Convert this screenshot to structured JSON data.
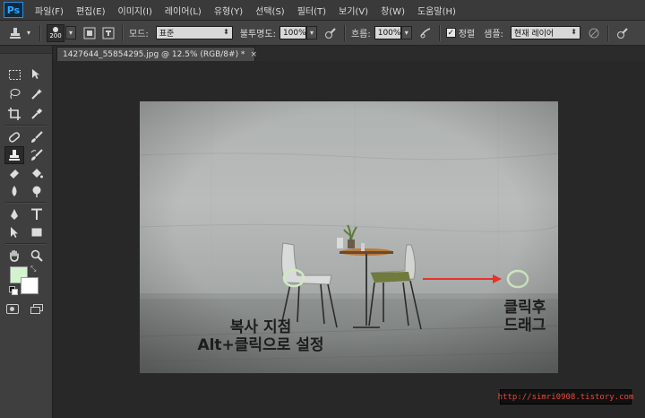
{
  "app": {
    "logo": "Ps"
  },
  "menu": [
    "파일(F)",
    "편집(E)",
    "이미지(I)",
    "레이어(L)",
    "유형(Y)",
    "선택(S)",
    "필터(T)",
    "보기(V)",
    "창(W)",
    "도움말(H)"
  ],
  "options_bar": {
    "brush_size": "200",
    "mode_label": "모드:",
    "mode_value": "표준",
    "opacity_label": "불투명도:",
    "opacity_value": "100%",
    "flow_label": "흐름:",
    "flow_value": "100%",
    "aligned_checked": true,
    "aligned_label": "정렬",
    "sample_label": "샘플:",
    "sample_value": "현재 레이어"
  },
  "document_tab": {
    "title": "1427644_55854295.jpg @ 12.5% (RGB/8#) *",
    "close": "×"
  },
  "colors": {
    "foreground": "#d3f3cf",
    "background": "#ffffff",
    "accent_red": "#e8312a",
    "circle_green": "#cfe9c0"
  },
  "tools": [
    "marquee-icon",
    "move-icon",
    "lasso-icon",
    "magic-wand-icon",
    "crop-icon",
    "eyedropper-icon",
    "spot-healing-icon",
    "brush-icon",
    "clone-stamp-icon",
    "history-brush-icon",
    "eraser-icon",
    "paint-bucket-icon",
    "blur-icon",
    "dodge-icon",
    "pen-icon",
    "type-icon",
    "path-selection-icon",
    "rectangle-icon",
    "hand-icon",
    "zoom-icon"
  ],
  "annotations": {
    "source_line1": "복사 지점",
    "source_line2": "Alt+클릭으로 설정",
    "target_line1": "클릭후",
    "target_line2": "드래그"
  },
  "watermark": "http://simri0908.tistory.com"
}
